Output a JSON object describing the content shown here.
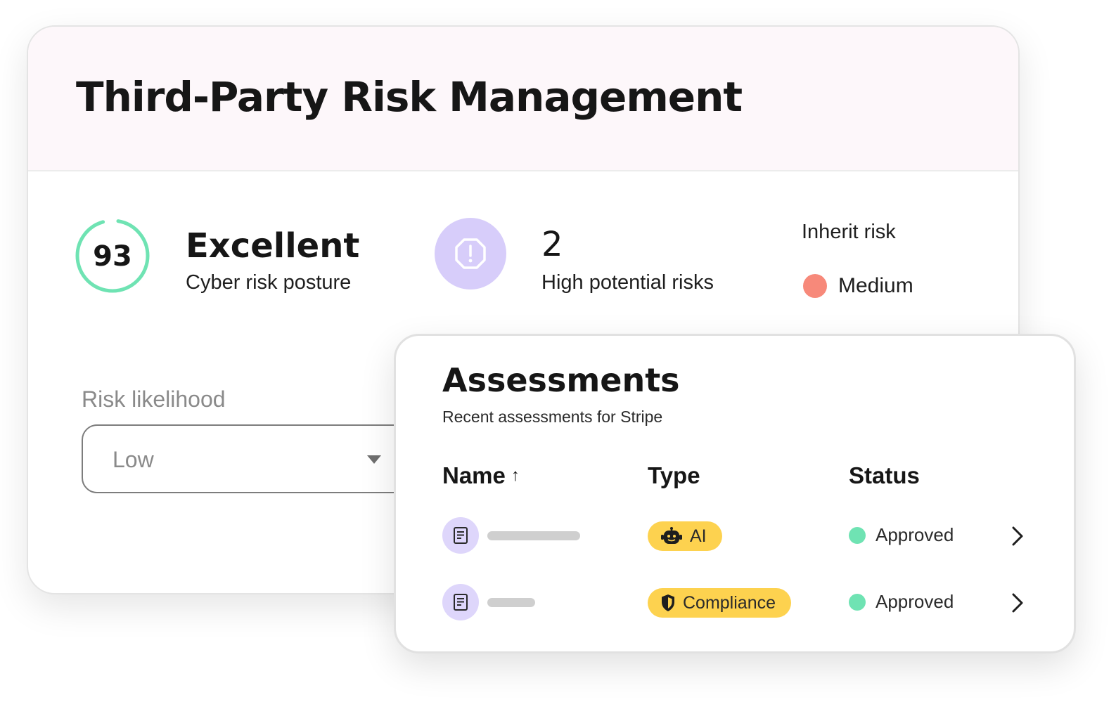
{
  "page": {
    "title": "Third-Party Risk Management"
  },
  "score": {
    "value": "93",
    "label": "Excellent",
    "subtitle": "Cyber risk posture",
    "ring_color": "#6fe3b3"
  },
  "risks": {
    "count": "2",
    "subtitle": "High potential risks",
    "icon": "alert-octagon-icon",
    "badge_color": "#d7cdfa"
  },
  "inherit": {
    "label": "Inherit risk",
    "value": "Medium",
    "dot_color": "#f7897a"
  },
  "likelihood": {
    "label": "Risk likelihood",
    "selected": "Low"
  },
  "assessments": {
    "title": "Assessments",
    "subtitle": "Recent assessments for Stripe",
    "columns": {
      "name": "Name",
      "type": "Type",
      "status": "Status"
    },
    "sort_icon": "arrow-up-icon",
    "rows": [
      {
        "type": "AI",
        "type_icon": "robot-icon",
        "status": "Approved",
        "status_color": "#6fe3b3"
      },
      {
        "type": "Compliance",
        "type_icon": "shield-icon",
        "status": "Approved",
        "status_color": "#6fe3b3"
      }
    ]
  },
  "colors": {
    "pill": "#fdd24f",
    "header_bg": "#fdf7fa",
    "doc_badge": "#ded6fb"
  }
}
